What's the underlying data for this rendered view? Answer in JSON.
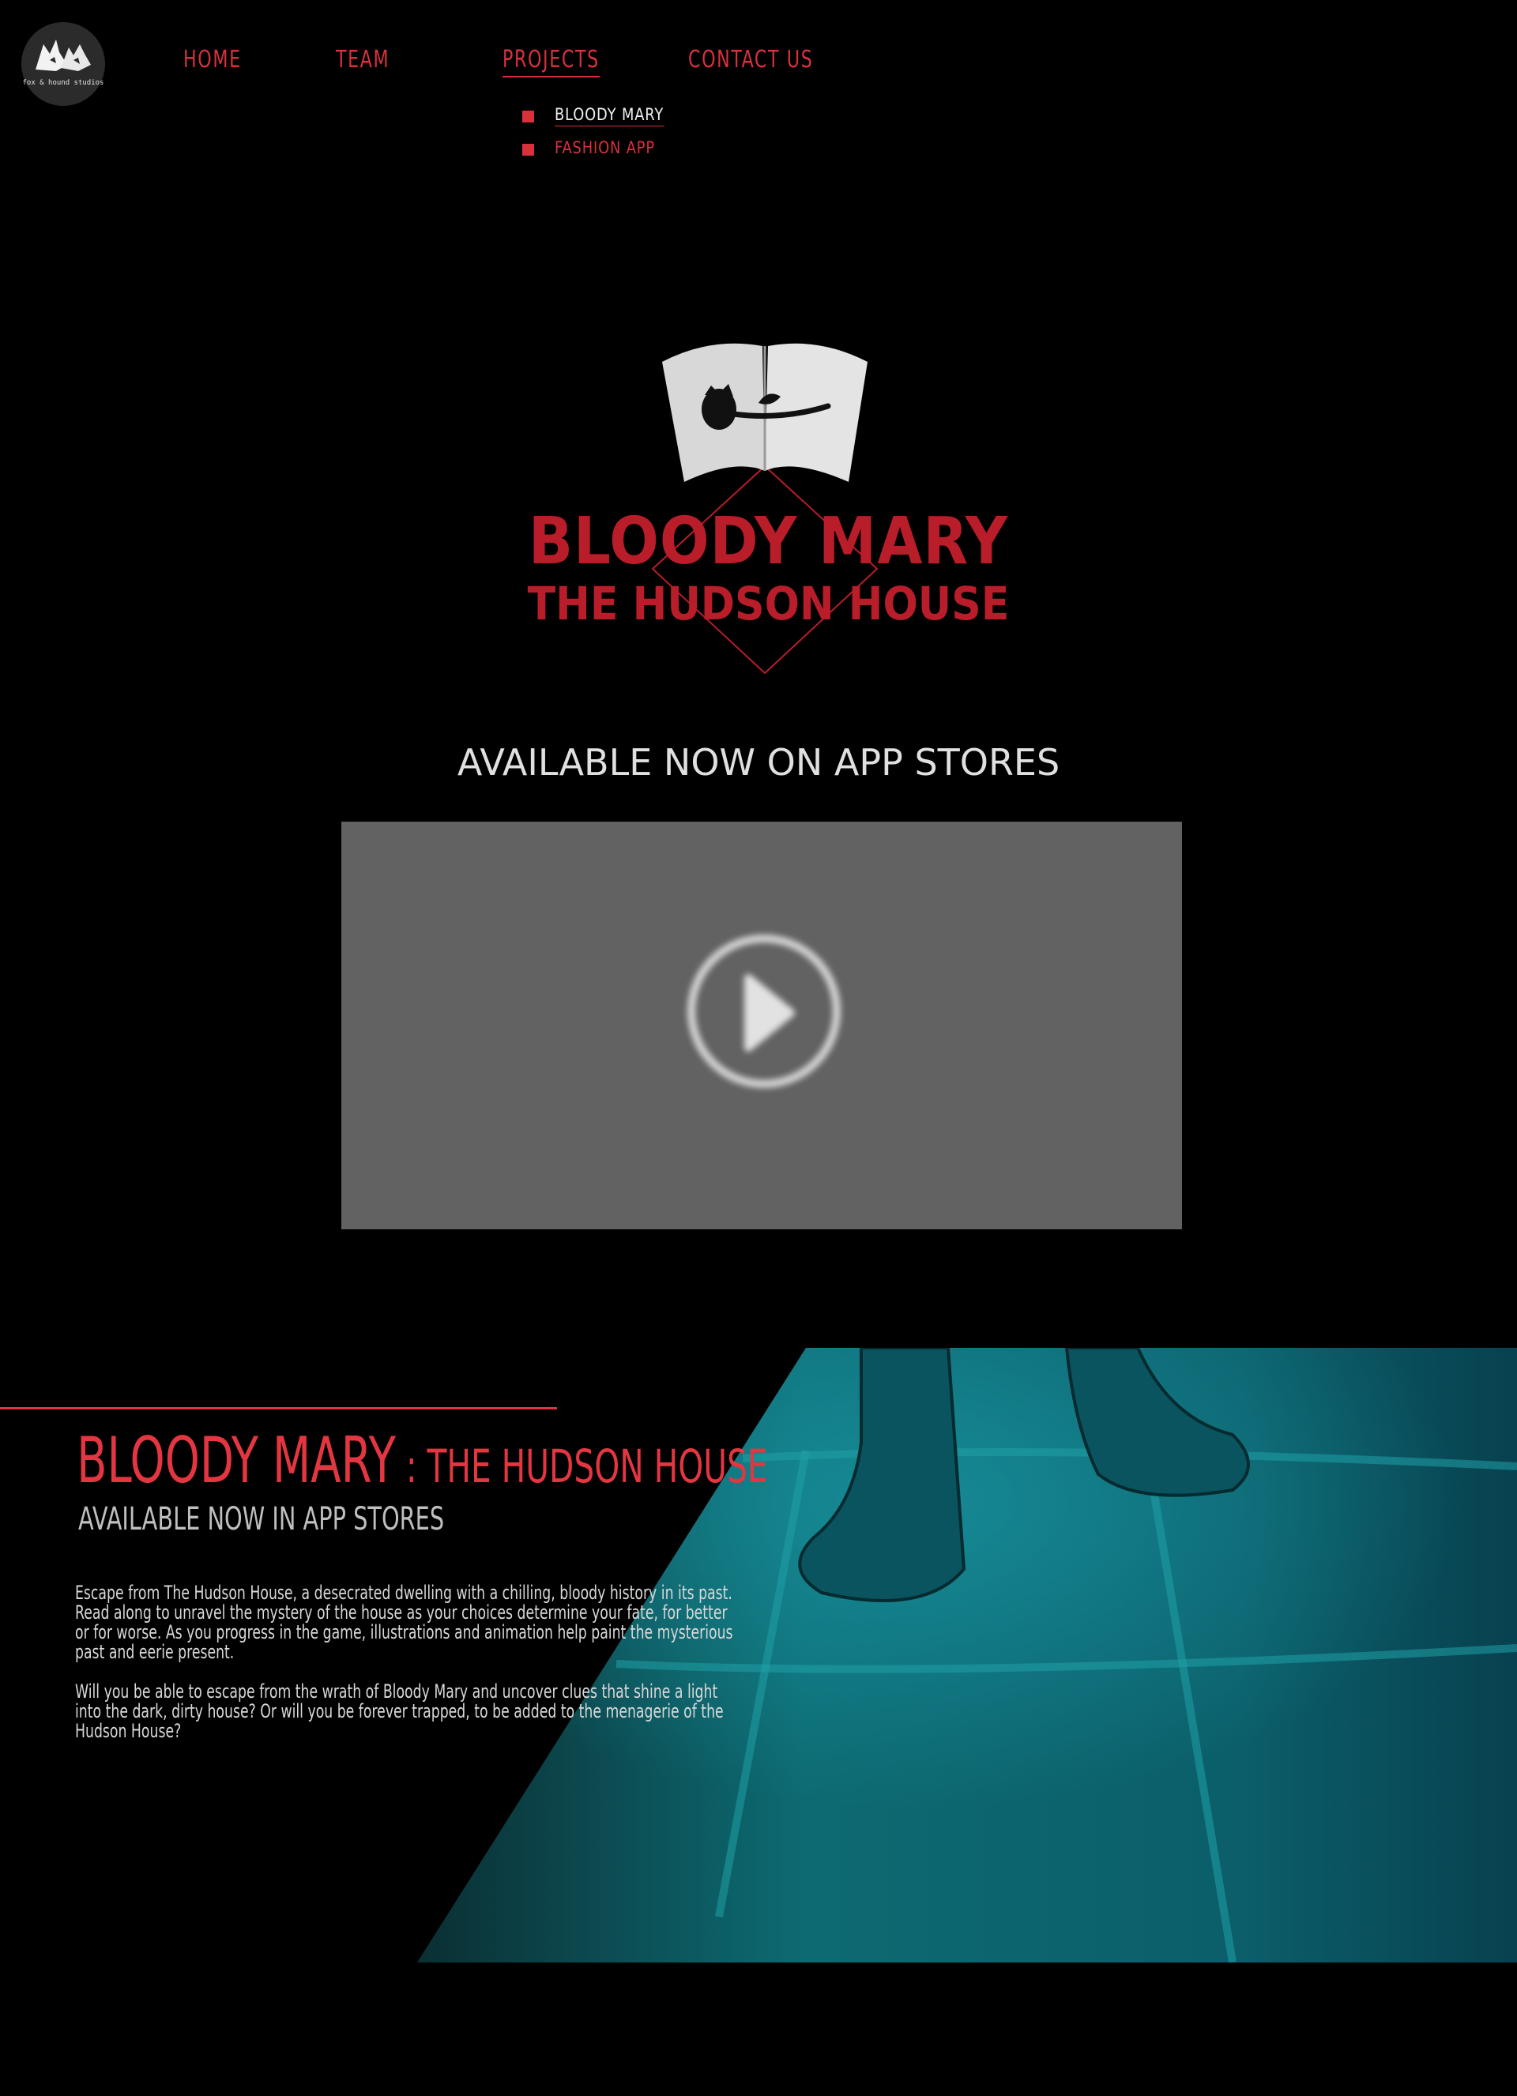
{
  "brand": {
    "logo_text": "fox & hound studios"
  },
  "nav": {
    "items": [
      {
        "label": "HOME"
      },
      {
        "label": "TEAM"
      },
      {
        "label": "PROJECTS"
      },
      {
        "label": "CONTACT US"
      }
    ],
    "active": "PROJECTS",
    "projects_submenu": [
      {
        "label": "BLOODY MARY"
      },
      {
        "label": "FASHION APP"
      }
    ]
  },
  "hero": {
    "title_line1": "BLOODY MARY",
    "title_line2": "THE HUDSON HOUSE",
    "logo_icon": "open-book-rose-icon"
  },
  "availability_heading": "AVAILABLE NOW ON APP STORES",
  "video": {
    "icon": "play-icon"
  },
  "feature": {
    "title_main": "BLOODY MARY",
    "title_sep": " : ",
    "title_sub": "THE HUDSON HOUSE",
    "subtitle": "AVAILABLE NOW IN APP STORES",
    "paragraph1": "Escape from The Hudson House, a desecrated dwelling with a chilling, bloody history in its past. Read along to unravel the mystery of the house as your choices determine your fate, for better or for worse. As you progress in the game, illustrations and animation help paint the mysterious past and eerie present.",
    "paragraph2": "Will you be able to escape from the wrath of Bloody Mary and uncover clues that shine a light into the dark, dirty house? Or will you be forever trapped, to be added to the menagerie of the Hudson House?"
  },
  "colors": {
    "accent": "#d9313c",
    "dark_red": "#b81d29",
    "teal": "#0f6f78",
    "background": "#000000"
  }
}
